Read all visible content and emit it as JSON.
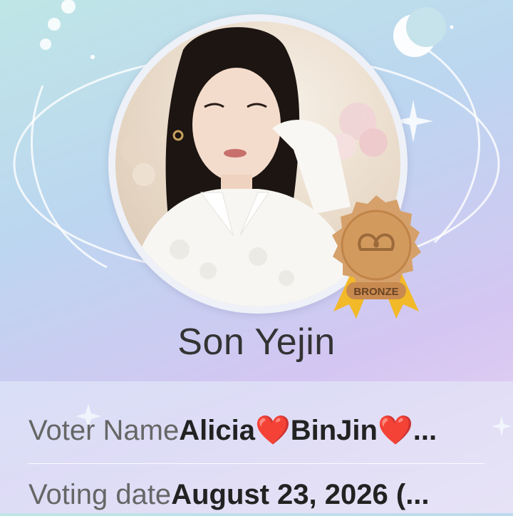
{
  "profile": {
    "name": "Son Yejin",
    "badge_label": "BRONZE",
    "badge_icon": "heart-loop-icon"
  },
  "details": {
    "voter_label": "Voter Name",
    "voter_value": "Alicia❤️BinJin❤️...",
    "date_label": "Voting date",
    "date_value": "August 23, 2026 (..."
  },
  "colors": {
    "badge": "#d39a5e",
    "ribbon": "#f2b928",
    "text": "#333333"
  }
}
